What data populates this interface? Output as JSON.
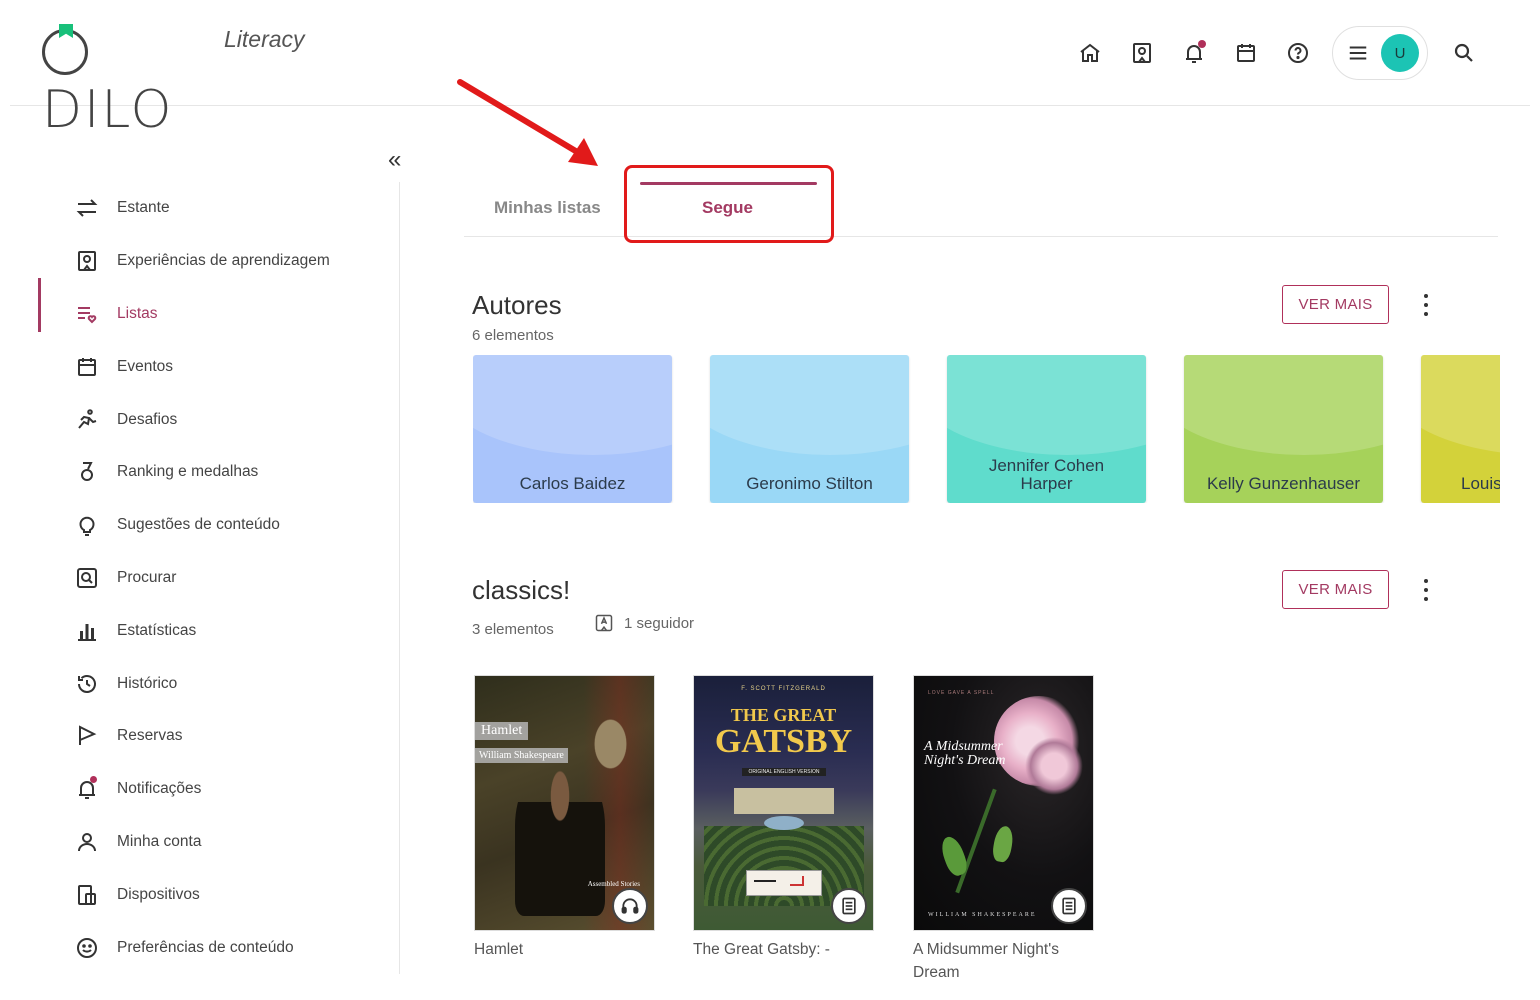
{
  "brand": {
    "name": "ODILO",
    "product": "Literacy"
  },
  "header": {
    "icons": [
      "home-icon",
      "learning-icon",
      "bell-icon",
      "calendar-icon",
      "help-icon",
      "menu-icon",
      "search-icon"
    ],
    "avatar_initial": "U"
  },
  "sidebar": {
    "collapse_glyph": "«",
    "items": [
      {
        "label": "Estante",
        "icon": "swap-arrows-icon"
      },
      {
        "label": "Experiências de aprendizagem",
        "icon": "learning-icon"
      },
      {
        "label": "Listas",
        "icon": "list-heart-icon",
        "active": true
      },
      {
        "label": "Eventos",
        "icon": "calendar-icon"
      },
      {
        "label": "Desafios",
        "icon": "runner-icon"
      },
      {
        "label": "Ranking e medalhas",
        "icon": "medal-icon"
      },
      {
        "label": "Sugestões de conteúdo",
        "icon": "lightbulb-icon"
      },
      {
        "label": "Procurar",
        "icon": "search-box-icon"
      },
      {
        "label": "Estatísticas",
        "icon": "bar-chart-icon"
      },
      {
        "label": "Histórico",
        "icon": "history-icon"
      },
      {
        "label": "Reservas",
        "icon": "flag-icon"
      },
      {
        "label": "Notificações",
        "icon": "bell-icon"
      },
      {
        "label": "Minha conta",
        "icon": "user-icon"
      },
      {
        "label": "Dispositivos",
        "icon": "devices-icon"
      },
      {
        "label": "Preferências de conteúdo",
        "icon": "smile-icon"
      }
    ]
  },
  "tabs": [
    {
      "label": "Minhas listas",
      "active": false
    },
    {
      "label": "Segue",
      "active": true
    }
  ],
  "sections": {
    "authors": {
      "title": "Autores",
      "count": "6 elementos",
      "button": "VER MAIS",
      "cards": [
        {
          "name": "Carlos Baidez",
          "color": "#a9c4fb"
        },
        {
          "name": "Geronimo Stilton",
          "color": "#9ad8f6"
        },
        {
          "name": "Jennifer Cohen Harper",
          "color": "#5fdccc"
        },
        {
          "name": "Kelly Gunzenhauser",
          "color": "#a6d25a"
        },
        {
          "name": "Louis",
          "color": "#d3d23a"
        }
      ]
    },
    "classics": {
      "title": "classics!",
      "count": "3 elementos",
      "followers": "1 seguidor",
      "button": "VER MAIS",
      "books": [
        {
          "title": "Hamlet",
          "format_icon": "headphones-icon",
          "cover_title": "Hamlet",
          "cover_author": "William Shakespeare",
          "cover_note": "Assembled Stories"
        },
        {
          "title": "The Great Gatsby: -",
          "format_icon": "ebook-icon",
          "cover_author": "F. SCOTT FITZGERALD",
          "cover_line1": "THE GREAT",
          "cover_line2": "GATSBY",
          "cover_note": "ORIGINAL ENGLISH VERSION"
        },
        {
          "title": "A Midsummer Night's Dream",
          "format_icon": "ebook-icon",
          "cover_top": "LOVE GAVE A SPELL",
          "cover_title": "A Midsummer Night's Dream",
          "cover_bottom": "WILLIAM SHAKESPEARE"
        }
      ]
    }
  },
  "colors": {
    "accent": "#a33a62",
    "annotation": "#e11a1a",
    "avatar": "#1cc4b4",
    "brand_flag": "#18c07a"
  }
}
